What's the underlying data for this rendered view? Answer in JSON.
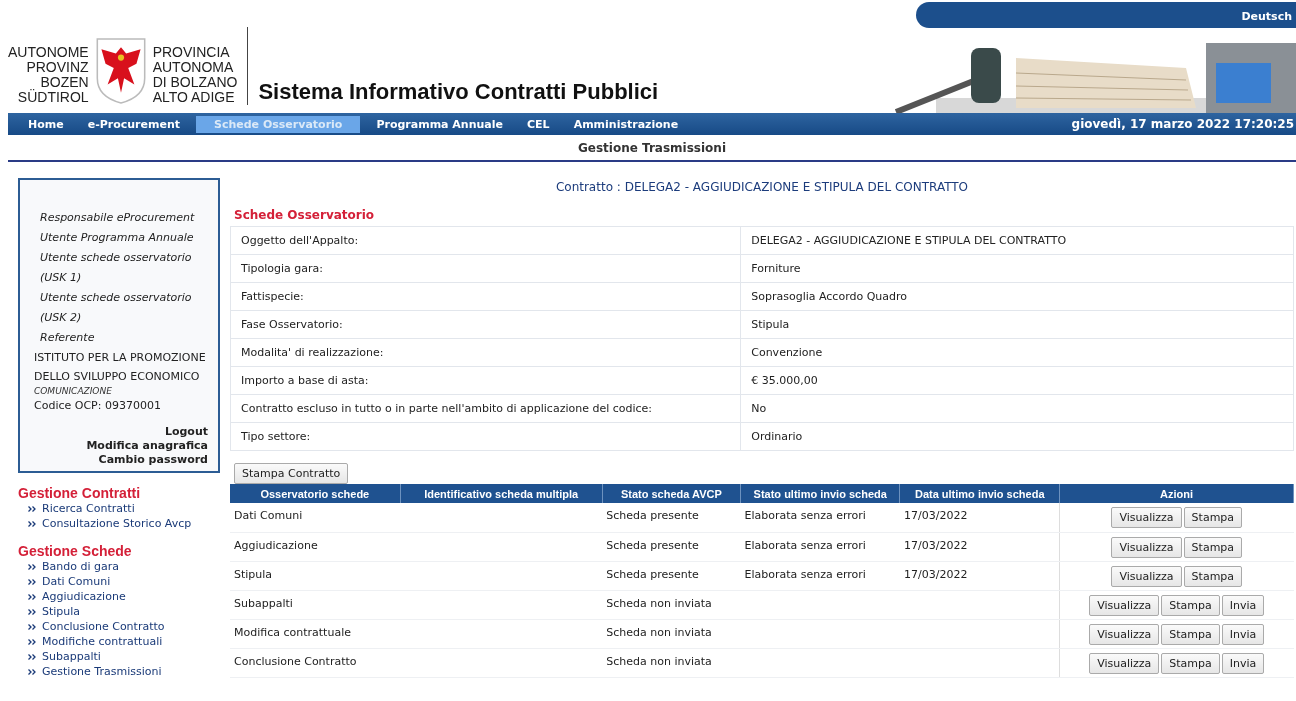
{
  "language_link": "Deutsch",
  "logo": {
    "german_lines": [
      "AUTONOME",
      "PROVINZ",
      "BOZEN",
      "SÜDTIROL"
    ],
    "italian_lines": [
      "PROVINCIA",
      "AUTONOMA",
      "DI BOLZANO",
      "ALTO ADIGE"
    ]
  },
  "app_title": "Sistema Informativo Contratti Pubblici",
  "nav": [
    {
      "label": "Home",
      "selected": false
    },
    {
      "label": "e-Procurement",
      "selected": false
    },
    {
      "label": "Schede Osservatorio",
      "selected": true
    },
    {
      "label": "Programma Annuale",
      "selected": false
    },
    {
      "label": "CEL",
      "selected": false
    },
    {
      "label": "Amministrazione",
      "selected": false
    }
  ],
  "datetime": "giovedì, 17 marzo 2022 17:20:25",
  "breadcrumb": "Gestione Trasmissioni",
  "user_box": {
    "roles": [
      "Responsabile eProcurement",
      "Utente Programma Annuale",
      "Utente schede osservatorio (USK 1)",
      "Utente schede osservatorio (USK 2)",
      "Referente"
    ],
    "organization": "ISTITUTO PER LA PROMOZIONE DELLO SVILUPPO ECONOMICO",
    "office": "COMUNICAZIONE",
    "code": "Codice OCP: 09370001",
    "links": [
      "Logout",
      "Modifica anagrafica",
      "Cambio password"
    ]
  },
  "menu": [
    {
      "title": "Gestione Contratti",
      "items": [
        "Ricerca Contratti",
        "Consultazione Storico Avcp"
      ]
    },
    {
      "title": "Gestione Schede",
      "items": [
        "Bando di gara",
        "Dati Comuni",
        "Aggiudicazione",
        "Stipula",
        "Conclusione Contratto",
        "Modifiche contrattuali",
        "Subappalti",
        "Gestione Trasmissioni"
      ]
    }
  ],
  "contract_heading": "Contratto : DELEGA2 - AGGIUDICAZIONE E STIPULA DEL CONTRATTO",
  "section_title": "Schede Osservatorio",
  "details": [
    [
      "Oggetto dell'Appalto:",
      "DELEGA2 - AGGIUDICAZIONE E STIPULA DEL CONTRATTO"
    ],
    [
      "Tipologia gara:",
      "Forniture"
    ],
    [
      "Fattispecie:",
      "Soprasoglia Accordo Quadro"
    ],
    [
      "Fase Osservatorio:",
      "Stipula"
    ],
    [
      "Modalita' di realizzazione:",
      "Convenzione"
    ],
    [
      "Importo a base di asta:",
      "€ 35.000,00"
    ],
    [
      "Contratto escluso in tutto o in parte nell'ambito di applicazione del codice:",
      "No"
    ],
    [
      "Tipo settore:",
      "Ordinario"
    ]
  ],
  "print_button": "Stampa Contratto",
  "table": {
    "columns": [
      "Osservatorio schede",
      "Identificativo scheda multipla",
      "Stato scheda AVCP",
      "Stato ultimo invio scheda",
      "Data ultimo invio scheda",
      "Azioni"
    ],
    "rows": [
      {
        "cells": [
          "Dati Comuni",
          "",
          "Scheda presente",
          "Elaborata senza errori",
          "17/03/2022"
        ],
        "actions": [
          "Visualizza",
          "Stampa"
        ]
      },
      {
        "cells": [
          "Aggiudicazione",
          "",
          "Scheda presente",
          "Elaborata senza errori",
          "17/03/2022"
        ],
        "actions": [
          "Visualizza",
          "Stampa"
        ]
      },
      {
        "cells": [
          "Stipula",
          "",
          "Scheda presente",
          "Elaborata senza errori",
          "17/03/2022"
        ],
        "actions": [
          "Visualizza",
          "Stampa"
        ]
      },
      {
        "cells": [
          "Subappalti",
          "",
          "Scheda non inviata",
          "",
          ""
        ],
        "actions": [
          "Visualizza",
          "Stampa",
          "Invia"
        ]
      },
      {
        "cells": [
          "Modifica contrattuale",
          "",
          "Scheda non inviata",
          "",
          ""
        ],
        "actions": [
          "Visualizza",
          "Stampa",
          "Invia"
        ]
      },
      {
        "cells": [
          "Conclusione Contratto",
          "",
          "Scheda non inviata",
          "",
          ""
        ],
        "actions": [
          "Visualizza",
          "Stampa",
          "Invia"
        ]
      }
    ]
  }
}
